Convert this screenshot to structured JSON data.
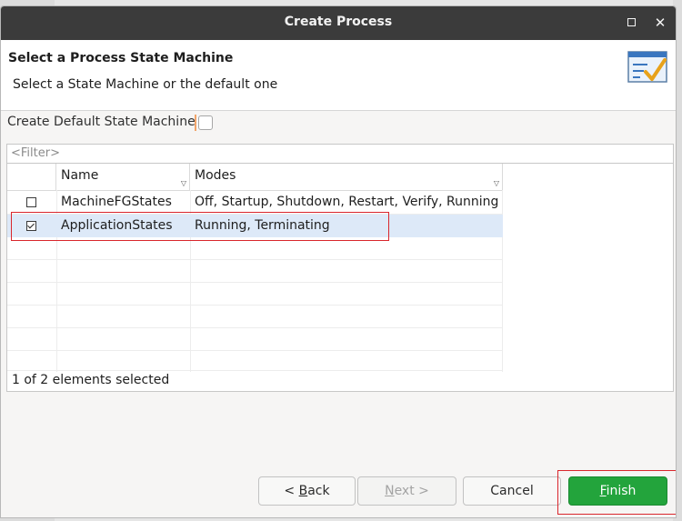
{
  "window": {
    "title": "Create Process"
  },
  "header": {
    "title": "Select a Process State Machine",
    "subtitle": "Select a State Machine or the default one"
  },
  "option": {
    "label": "Create Default State Machine",
    "checked": false
  },
  "filter": {
    "placeholder": "<Filter>"
  },
  "table": {
    "columns": [
      "Name",
      "Modes"
    ],
    "rows": [
      {
        "checked": false,
        "name": "MachineFGStates",
        "modes": "Off, Startup, Shutdown, Restart, Verify, Running"
      },
      {
        "checked": true,
        "name": "ApplicationStates",
        "modes": "Running, Terminating"
      }
    ],
    "status": "1 of 2 elements selected"
  },
  "buttons": {
    "back_mnemonic": "B",
    "back_rest": "ack",
    "next_mnemonic": "N",
    "next_rest": "ext",
    "cancel": "Cancel",
    "finish_mnemonic": "F",
    "finish_rest": "inish"
  },
  "colors": {
    "accent": "#23a43c",
    "highlight": "#d9262c",
    "selection": "#dde9f8"
  }
}
